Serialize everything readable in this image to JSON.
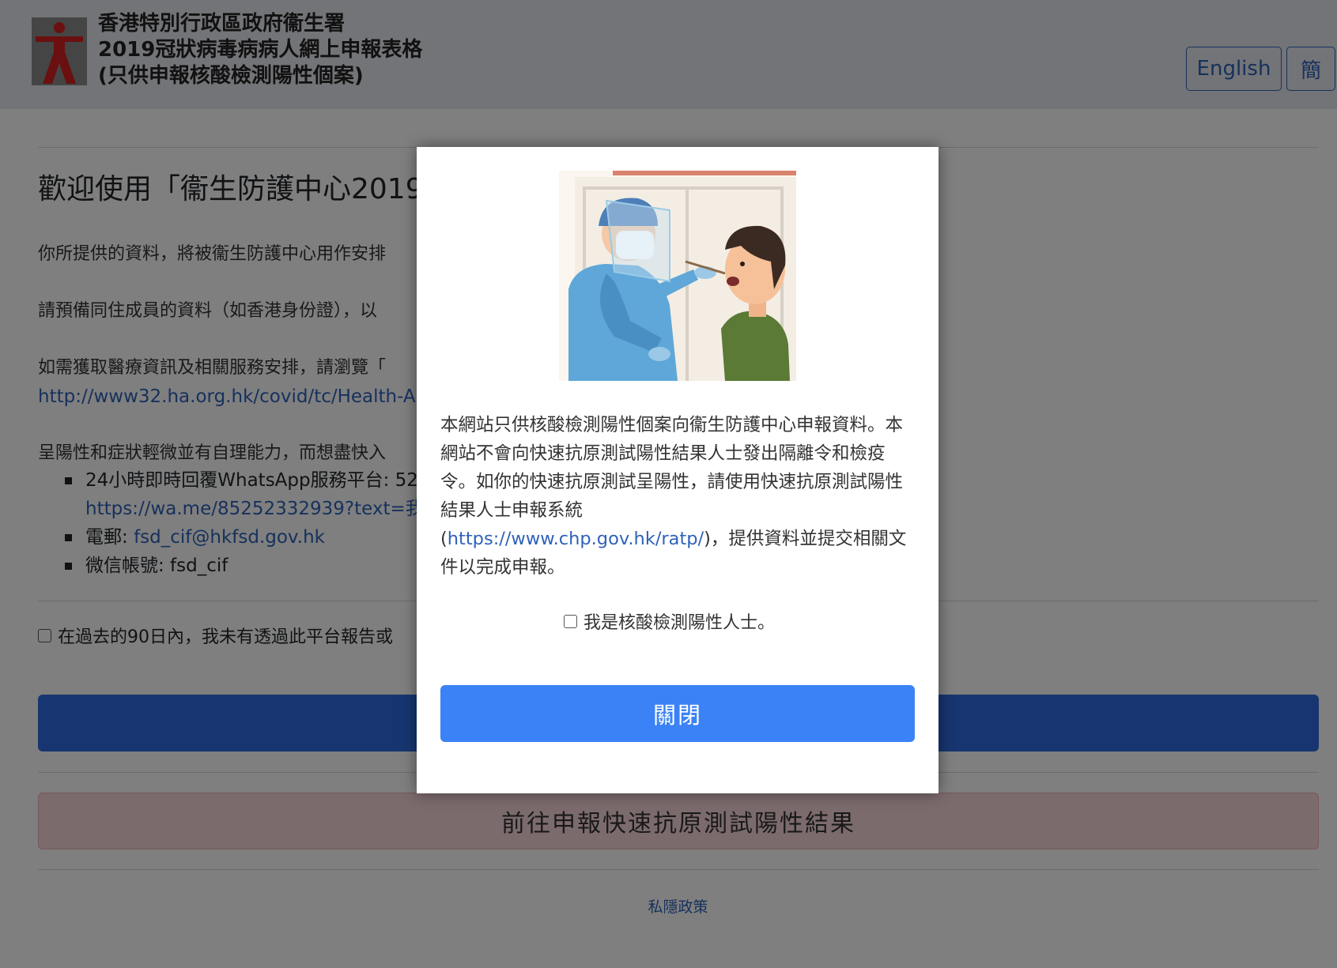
{
  "header": {
    "title_lines": [
      "香港特別行政區政府衞生署",
      "2019冠狀病毒病病人網上申報表格",
      "(只供申報核酸檢測陽性個案)"
    ],
    "lang_english": "English",
    "lang_simplified": "簡"
  },
  "main": {
    "welcome": "歡迎使用「衞生防護中心2019",
    "para1": "你所提供的資料，將被衞生防護中心用作安排",
    "para2": "請預備同住成員的資料（如香港身份證），以",
    "para3": "如需獲取醫療資訊及相關服務安排，請瀏覽「",
    "para3_link": "http://www32.ha.org.hk/covid/tc/Health-A",
    "para4": "呈陽性和症狀輕微並有自理能力，而想盡快入",
    "list": {
      "whatsapp": "24小時即時回覆WhatsApp服務平台: 52",
      "whatsapp_link": "https://wa.me/85252332939?text=我",
      "email_label": "電郵: ",
      "email_link": "fsd_cif@hkfsd.gov.hk",
      "wechat": "微信帳號: fsd_cif"
    },
    "checkbox_text": "在過去的90日內，我未有透過此平台報告或",
    "rat_button": "前往申報快速抗原測試陽性結果",
    "privacy": "私隱政策"
  },
  "modal": {
    "text_part1": "本網站只供核酸檢測陽性個案向衞生防護中心申報資料。本網站不會向快速抗原測試陽性結果人士發出隔離令和檢疫令。如你的快速抗原測試呈陽性，請使用快速抗原測試陽性結果人士申報系統",
    "text_open_paren": "(",
    "text_link": "https://www.chp.gov.hk/ratp/",
    "text_part2": ")，提供資料並提交相關文件以完成申報。",
    "checkbox_label": "我是核酸檢測陽性人士。",
    "close_button": "關閉"
  },
  "colors": {
    "link": "#2f62b9",
    "primary": "#3b82f6",
    "page_primary": "#2f6be0",
    "danger_light": "#f8d7da"
  }
}
